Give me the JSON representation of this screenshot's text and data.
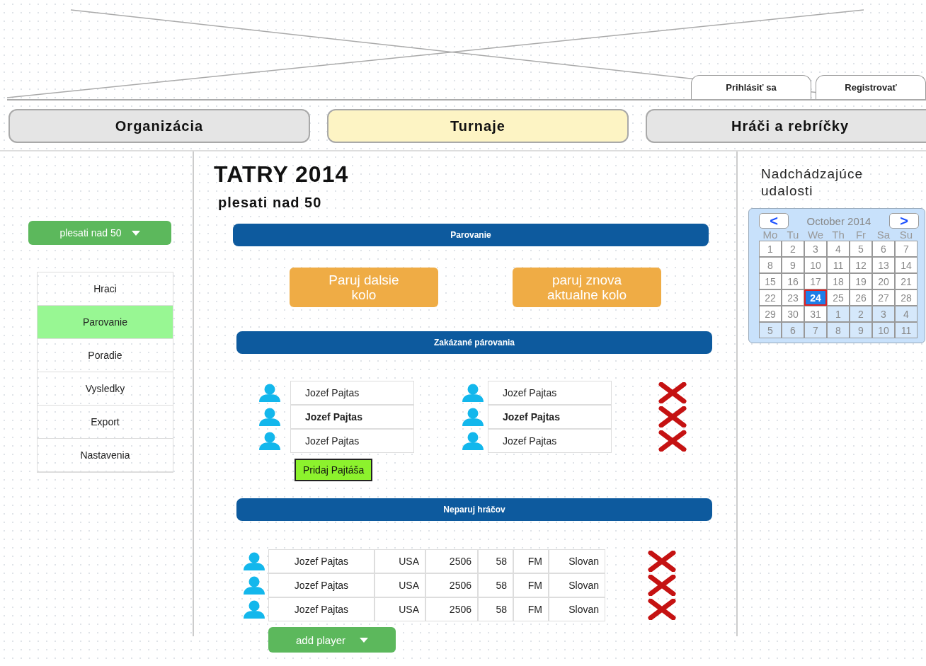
{
  "header": {
    "banner": {
      "kind": "placeholder"
    },
    "auth_buttons": [
      "Prihlásiť sa",
      "Registrovať"
    ]
  },
  "nav_tabs": [
    {
      "label": "Organizácia",
      "selected": false
    },
    {
      "label": "Turnaje",
      "selected": true
    },
    {
      "label": "Hráči a rebríčky",
      "selected": false
    }
  ],
  "sidebar": {
    "category_dropdown": "plesati nad 50",
    "items": [
      {
        "label": "Hraci",
        "selected": false
      },
      {
        "label": "Parovanie",
        "selected": true
      },
      {
        "label": "Poradie",
        "selected": false
      },
      {
        "label": "Vysledky",
        "selected": false
      },
      {
        "label": "Export",
        "selected": false
      },
      {
        "label": "Nastavenia",
        "selected": false
      }
    ]
  },
  "main": {
    "title": "TATRY 2014",
    "subtitle": "plesati nad 50",
    "pairing": {
      "heading": "Parovanie",
      "buttons": [
        "Paruj dalsie kolo",
        "paruj znova aktualne kolo"
      ]
    },
    "forbidden": {
      "heading": "Zakázané párovania",
      "pairs": [
        {
          "left": "Jozef Pajtas",
          "right": "Jozef Pajtas",
          "emphasized": false
        },
        {
          "left": "Jozef Pajtas",
          "right": "Jozef Pajtas",
          "emphasized": true
        },
        {
          "left": "Jozef Pajtas",
          "right": "Jozef Pajtas",
          "emphasized": false
        }
      ],
      "add_button": "Pridaj Pajtáša"
    },
    "do_not_pair": {
      "heading": "Neparuj hráčov",
      "rows": [
        {
          "cells": [
            "Jozef Pajtas",
            "USA",
            "2506",
            "58",
            "FM",
            "Slovan"
          ]
        },
        {
          "cells": [
            "Jozef Pajtas",
            "USA",
            "2506",
            "58",
            "FM",
            "Slovan"
          ]
        },
        {
          "cells": [
            "Jozef Pajtas",
            "USA",
            "2506",
            "58",
            "FM",
            "Slovan"
          ]
        }
      ],
      "add_button": "add player"
    }
  },
  "events": {
    "title": "Nadchádzajúce udalosti",
    "calendar": {
      "month": "October 2014",
      "prev": "<",
      "next": ">",
      "weekdays": [
        "Mo",
        "Tu",
        "We",
        "Th",
        "Fr",
        "Sa",
        "Su"
      ],
      "days": [
        {
          "label": "1",
          "in_month": true,
          "selected": false
        },
        {
          "label": "2",
          "in_month": true,
          "selected": false
        },
        {
          "label": "3",
          "in_month": true,
          "selected": false
        },
        {
          "label": "4",
          "in_month": true,
          "selected": false
        },
        {
          "label": "5",
          "in_month": true,
          "selected": false
        },
        {
          "label": "6",
          "in_month": true,
          "selected": false
        },
        {
          "label": "7",
          "in_month": true,
          "selected": false
        },
        {
          "label": "8",
          "in_month": true,
          "selected": false
        },
        {
          "label": "9",
          "in_month": true,
          "selected": false
        },
        {
          "label": "10",
          "in_month": true,
          "selected": false
        },
        {
          "label": "11",
          "in_month": true,
          "selected": false
        },
        {
          "label": "12",
          "in_month": true,
          "selected": false
        },
        {
          "label": "13",
          "in_month": true,
          "selected": false
        },
        {
          "label": "14",
          "in_month": true,
          "selected": false
        },
        {
          "label": "15",
          "in_month": true,
          "selected": false
        },
        {
          "label": "16",
          "in_month": true,
          "selected": false
        },
        {
          "label": "17",
          "in_month": true,
          "selected": false
        },
        {
          "label": "18",
          "in_month": true,
          "selected": false
        },
        {
          "label": "19",
          "in_month": true,
          "selected": false
        },
        {
          "label": "20",
          "in_month": true,
          "selected": false
        },
        {
          "label": "21",
          "in_month": true,
          "selected": false
        },
        {
          "label": "22",
          "in_month": true,
          "selected": false
        },
        {
          "label": "23",
          "in_month": true,
          "selected": false
        },
        {
          "label": "24",
          "in_month": true,
          "selected": true
        },
        {
          "label": "25",
          "in_month": true,
          "selected": false
        },
        {
          "label": "26",
          "in_month": true,
          "selected": false
        },
        {
          "label": "27",
          "in_month": true,
          "selected": false
        },
        {
          "label": "28",
          "in_month": true,
          "selected": false
        },
        {
          "label": "29",
          "in_month": true,
          "selected": false
        },
        {
          "label": "30",
          "in_month": true,
          "selected": false
        },
        {
          "label": "31",
          "in_month": true,
          "selected": false
        },
        {
          "label": "1",
          "in_month": false,
          "selected": false
        },
        {
          "label": "2",
          "in_month": false,
          "selected": false
        },
        {
          "label": "3",
          "in_month": false,
          "selected": false
        },
        {
          "label": "4",
          "in_month": false,
          "selected": false
        },
        {
          "label": "5",
          "in_month": false,
          "selected": false
        },
        {
          "label": "6",
          "in_month": false,
          "selected": false
        },
        {
          "label": "7",
          "in_month": false,
          "selected": false
        },
        {
          "label": "8",
          "in_month": false,
          "selected": false
        },
        {
          "label": "9",
          "in_month": false,
          "selected": false
        },
        {
          "label": "10",
          "in_month": false,
          "selected": false
        },
        {
          "label": "11",
          "in_month": false,
          "selected": false
        }
      ]
    }
  }
}
